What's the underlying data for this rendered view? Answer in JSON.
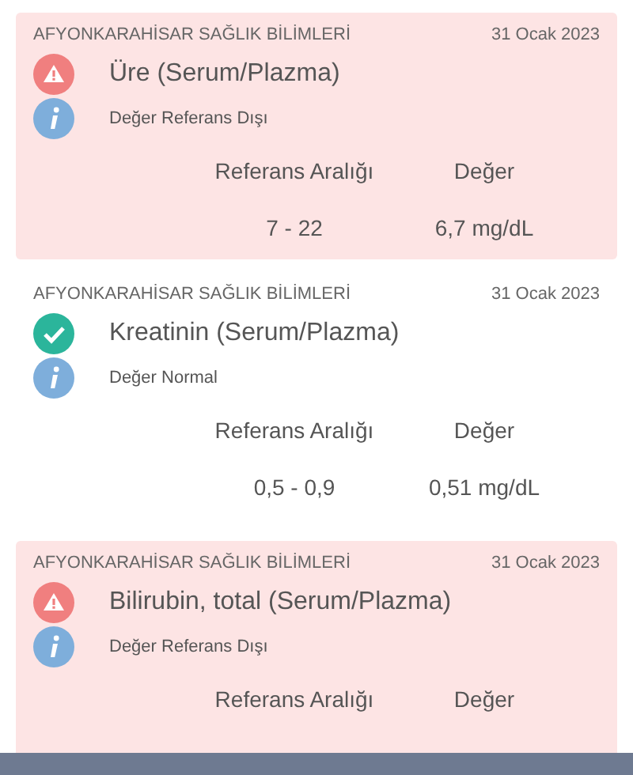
{
  "results": [
    {
      "institution": "AFYONKARAHİSAR SAĞLIK BİLİMLERİ",
      "date": "31 Ocak 2023",
      "kind": "warning",
      "test": "Üre (Serum/Plazma)",
      "note": "Değer Referans Dışı",
      "range_label": "Referans Aralığı",
      "value_label": "Değer",
      "range": "7 - 22",
      "value": "6,7 mg/dL"
    },
    {
      "institution": "AFYONKARAHİSAR SAĞLIK BİLİMLERİ",
      "date": "31 Ocak 2023",
      "kind": "normal",
      "test": "Kreatinin (Serum/Plazma)",
      "note": "Değer Normal",
      "range_label": "Referans Aralığı",
      "value_label": "Değer",
      "range": "0,5 - 0,9",
      "value": "0,51 mg/dL"
    },
    {
      "institution": "AFYONKARAHİSAR SAĞLIK BİLİMLERİ",
      "date": "31 Ocak 2023",
      "kind": "warning",
      "test": "Bilirubin, total (Serum/Plazma)",
      "note": "Değer Referans Dışı",
      "range_label": "Referans Aralığı",
      "value_label": "Değer"
    }
  ]
}
